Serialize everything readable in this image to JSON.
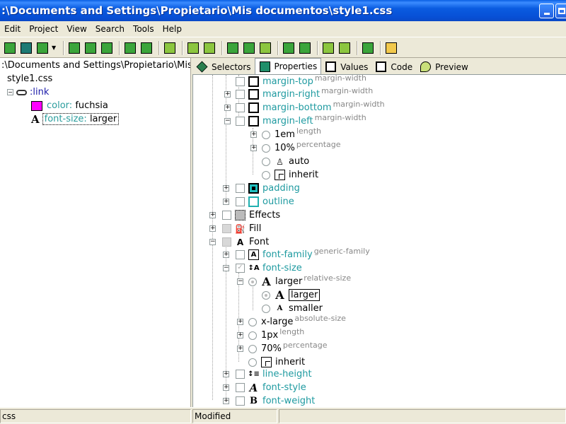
{
  "window": {
    "title": ":\\Documents and Settings\\Propietario\\Mis documentos\\style1.css"
  },
  "menu": [
    "Edit",
    "Project",
    "View",
    "Search",
    "Tools",
    "Help"
  ],
  "left_panel": {
    "path": ":\\Documents and Settings\\Propietario\\Mis do",
    "file": "style1.css",
    "selector": ":link",
    "prop1": {
      "name": "color:",
      "value": "fuchsia",
      "swatch_color": "#ff00ff"
    },
    "prop2": {
      "name": "font-size:",
      "value": "larger"
    }
  },
  "tabs": [
    {
      "label": "Selectors",
      "icon": "diamond-icon"
    },
    {
      "label": "Properties",
      "icon": "properties-icon"
    },
    {
      "label": "Values",
      "icon": "values-icon"
    },
    {
      "label": "Code",
      "icon": "code-icon"
    },
    {
      "label": "Preview",
      "icon": "preview-icon"
    }
  ],
  "tree": {
    "margin_top": {
      "name": "margin-top",
      "hint": "margin-width"
    },
    "margin_right": {
      "name": "margin-right",
      "hint": "margin-width"
    },
    "margin_bottom": {
      "name": "margin-bottom",
      "hint": "margin-width"
    },
    "margin_left": {
      "name": "margin-left",
      "hint": "margin-width"
    },
    "em": {
      "name": "1em",
      "hint": "length"
    },
    "pct": {
      "name": "10%",
      "hint": "percentage"
    },
    "auto": {
      "name": "auto"
    },
    "inherit1": {
      "name": "inherit"
    },
    "padding": {
      "name": "padding"
    },
    "outline": {
      "name": "outline"
    },
    "effects": {
      "name": "Effects"
    },
    "fill": {
      "name": "Fill"
    },
    "font": {
      "name": "Font"
    },
    "font_family": {
      "name": "font-family",
      "hint": "generic-family"
    },
    "font_size": {
      "name": "font-size"
    },
    "larger_group": {
      "name": "larger",
      "hint": "relative-size"
    },
    "larger_item": {
      "name": "larger"
    },
    "smaller": {
      "name": "smaller"
    },
    "xlarge": {
      "name": "x-large",
      "hint": "absolute-size"
    },
    "px": {
      "name": "1px",
      "hint": "length"
    },
    "pct70": {
      "name": "70%",
      "hint": "percentage"
    },
    "inherit2": {
      "name": "inherit"
    },
    "line_height": {
      "name": "line-height"
    },
    "font_style": {
      "name": "font-style"
    },
    "font_weight": {
      "name": "font-weight"
    }
  },
  "status": {
    "left": "css",
    "middle": "Modified"
  }
}
